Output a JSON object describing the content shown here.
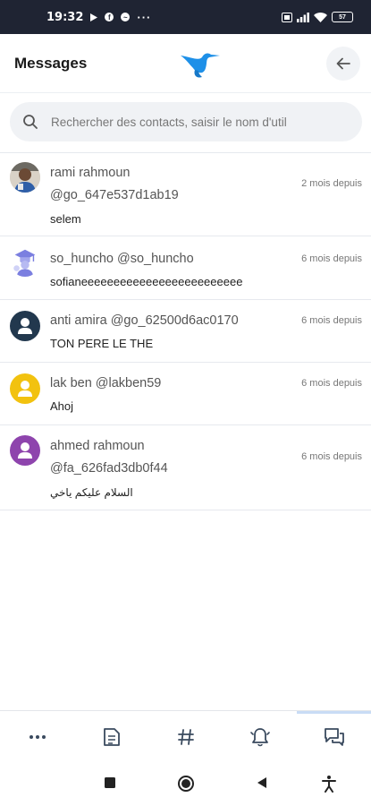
{
  "status_bar": {
    "time": "19:32",
    "battery": "57"
  },
  "header": {
    "title": "Messages"
  },
  "search": {
    "placeholder": "Rechercher des contacts, saisir le nom d'util"
  },
  "conversations": [
    {
      "name": "rami rahmoun",
      "handle": "@go_647e537d1ab19",
      "message": "selem",
      "time": "2 mois depuis",
      "avatar": "photo-avatar"
    },
    {
      "name": "so_huncho",
      "handle": "@so_huncho",
      "message": "sofianeeeeeeeeeeeeeeeeeeeeeeeee",
      "time": "6 mois depuis",
      "avatar": "graduate-avatar"
    },
    {
      "name": "anti amira",
      "handle": "@go_62500d6ac0170",
      "message": "TON PERE LE THE",
      "time": "6 mois depuis",
      "avatar": "default-avatar",
      "avatar_color": "#22384e"
    },
    {
      "name": "lak ben",
      "handle": "@lakben59",
      "message": "Ahoj",
      "time": "6 mois depuis",
      "avatar": "default-avatar",
      "avatar_color": "#f2c20f"
    },
    {
      "name": "ahmed rahmoun",
      "handle": "@fa_626fad3db0f44",
      "message": "السلام عليكم ياخي",
      "time": "6 mois depuis",
      "avatar": "default-avatar",
      "avatar_color": "#8e44ad"
    }
  ],
  "bottom_nav": [
    {
      "icon": "more-icon"
    },
    {
      "icon": "document-icon"
    },
    {
      "icon": "hashtag-icon"
    },
    {
      "icon": "bell-icon"
    },
    {
      "icon": "chat-icon",
      "active": true
    }
  ],
  "colors": {
    "status_bar_bg": "#1f2433",
    "brand_blue": "#1e90e8",
    "active_tab_indicator": "#c9dcf5"
  }
}
